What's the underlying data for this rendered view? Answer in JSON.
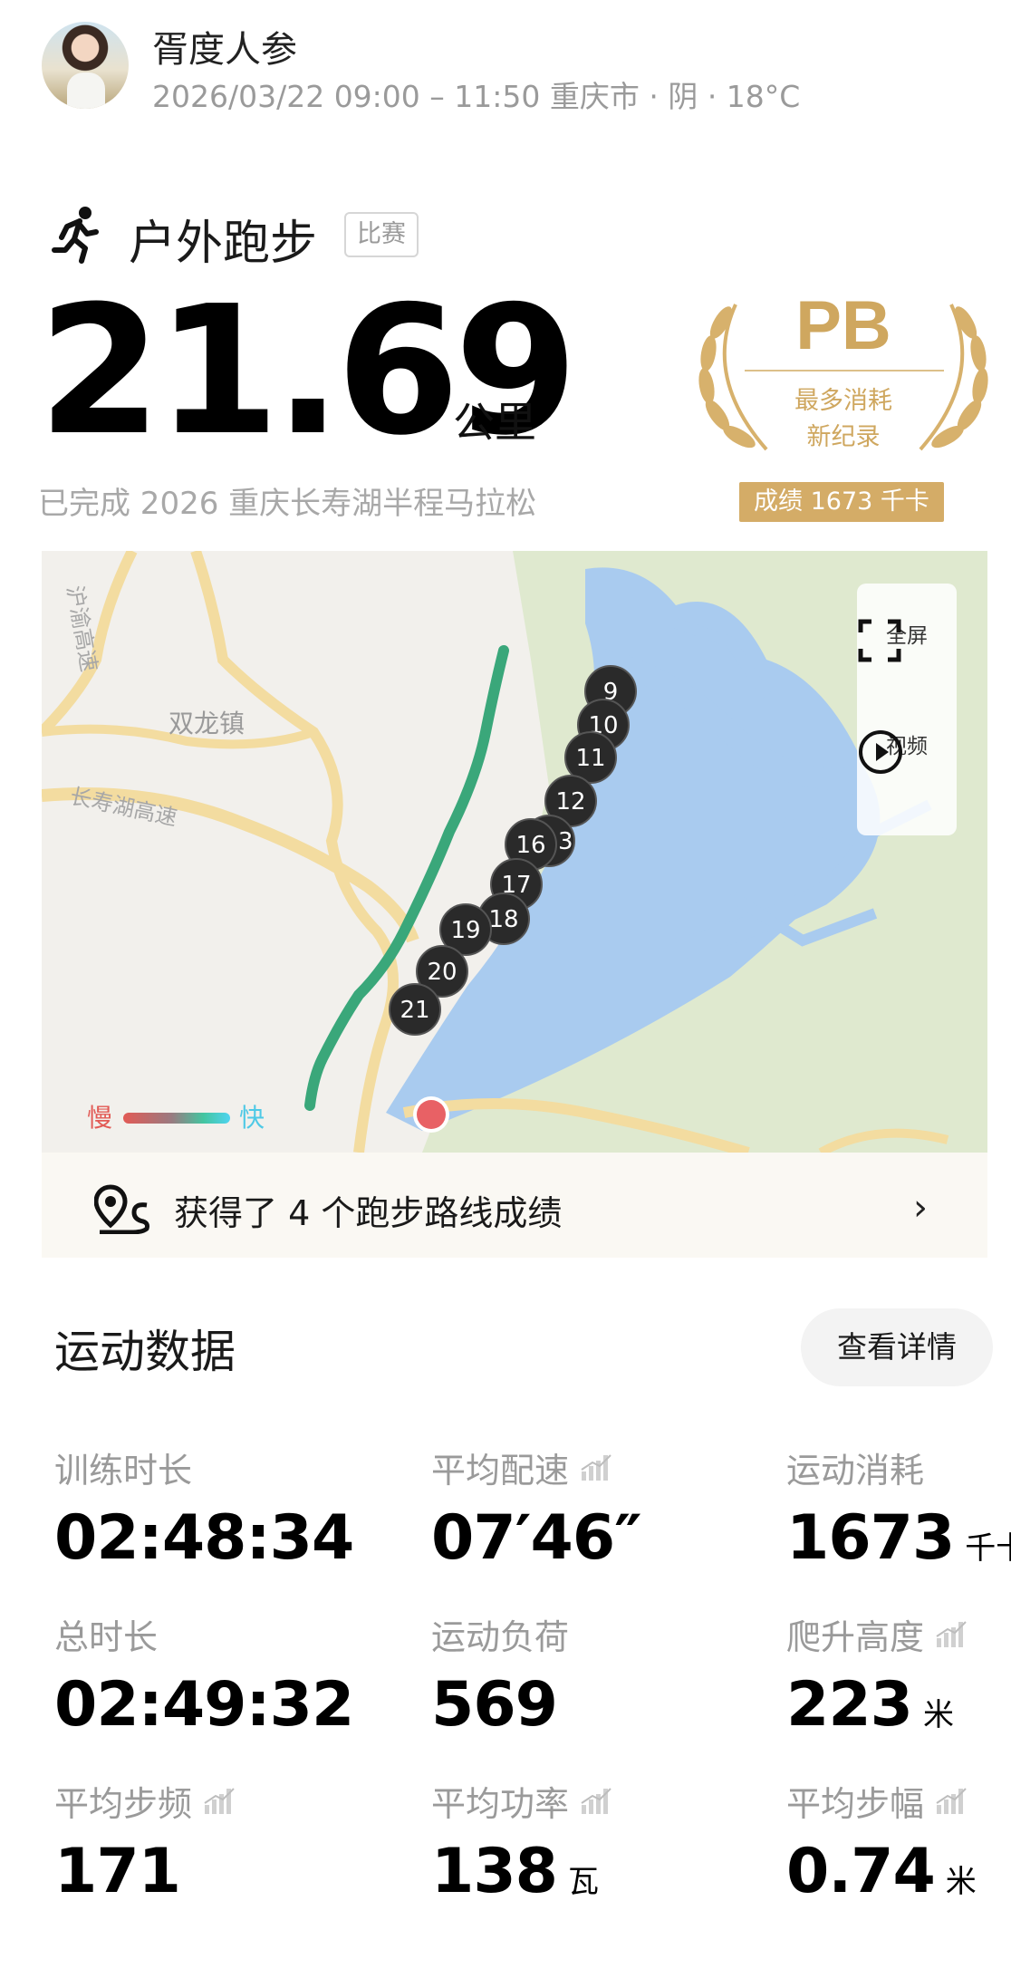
{
  "header": {
    "username": "胥度人参",
    "subline": "2026/03/22 09:00 – 11:50 重庆市 · 阴 · 18°C"
  },
  "activity": {
    "sport": "户外跑步",
    "tag": "比赛",
    "distance": "21.69",
    "distance_unit": "公里",
    "completed": "已完成 2026 重庆长寿湖半程马拉松"
  },
  "pb": {
    "title": "PB",
    "line1": "最多消耗",
    "line2": "新纪录",
    "score": "成绩 1673 千卡",
    "accent": "#cfa75f"
  },
  "map": {
    "labels": {
      "highway1": "沪渝高速",
      "town": "双龙镇",
      "highway2": "长寿湖高速"
    },
    "markers": [
      "9",
      "10",
      "11",
      "12",
      "16",
      "13",
      "17",
      "18",
      "19",
      "20",
      "21"
    ],
    "controls": {
      "fullscreen": "全屏",
      "video": "视频"
    },
    "legend": {
      "slow": "慢",
      "fast": "快"
    }
  },
  "route": {
    "text": "获得了 4 个跑步路线成绩"
  },
  "stats": {
    "title": "运动数据",
    "details": "查看详情",
    "items": [
      {
        "label": "训练时长",
        "value": "02:48:34",
        "unit": ""
      },
      {
        "label": "平均配速",
        "value": "07′46″",
        "unit": ""
      },
      {
        "label": "运动消耗",
        "value": "1673",
        "unit": "千卡"
      },
      {
        "label": "总时长",
        "value": "02:49:32",
        "unit": ""
      },
      {
        "label": "运动负荷",
        "value": "569",
        "unit": ""
      },
      {
        "label": "爬升高度",
        "value": "223",
        "unit": "米"
      },
      {
        "label": "平均步频",
        "value": "171",
        "unit": ""
      },
      {
        "label": "平均功率",
        "value": "138",
        "unit": "瓦"
      },
      {
        "label": "平均步幅",
        "value": "0.74",
        "unit": "米"
      }
    ]
  }
}
